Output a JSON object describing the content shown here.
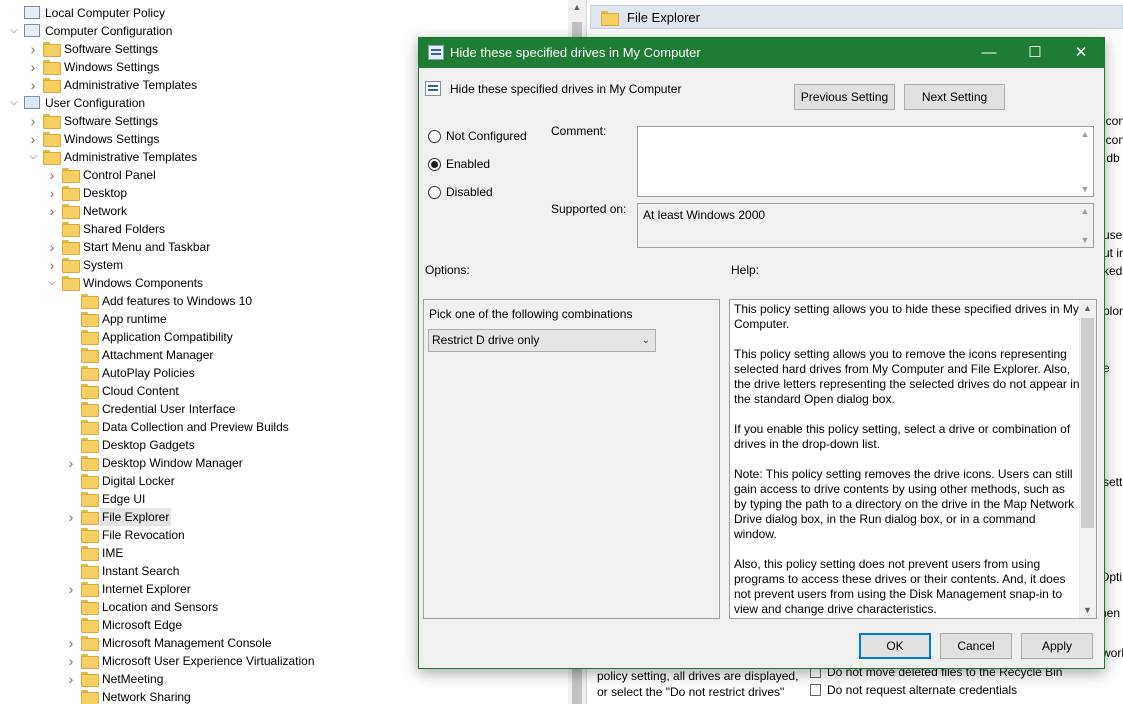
{
  "tree": {
    "items": [
      {
        "label": "Local Computer Policy",
        "level": 0,
        "chevron": "",
        "icon": "policy"
      },
      {
        "label": "Computer Configuration",
        "level": 0,
        "chevron": "down",
        "icon": "computer"
      },
      {
        "label": "Software Settings",
        "level": 1,
        "chevron": "right",
        "icon": "folder"
      },
      {
        "label": "Windows Settings",
        "level": 1,
        "chevron": "right",
        "icon": "folder"
      },
      {
        "label": "Administrative Templates",
        "level": 1,
        "chevron": "right",
        "icon": "folder"
      },
      {
        "label": "User Configuration",
        "level": 0,
        "chevron": "down",
        "icon": "user"
      },
      {
        "label": "Software Settings",
        "level": 1,
        "chevron": "right",
        "icon": "folder"
      },
      {
        "label": "Windows Settings",
        "level": 1,
        "chevron": "right",
        "icon": "folder"
      },
      {
        "label": "Administrative Templates",
        "level": 1,
        "chevron": "down",
        "icon": "folder"
      },
      {
        "label": "Control Panel",
        "level": 2,
        "chevron": "right",
        "icon": "folder"
      },
      {
        "label": "Desktop",
        "level": 2,
        "chevron": "right",
        "icon": "folder"
      },
      {
        "label": "Network",
        "level": 2,
        "chevron": "right",
        "icon": "folder"
      },
      {
        "label": "Shared Folders",
        "level": 2,
        "chevron": "",
        "icon": "folder"
      },
      {
        "label": "Start Menu and Taskbar",
        "level": 2,
        "chevron": "right",
        "icon": "folder"
      },
      {
        "label": "System",
        "level": 2,
        "chevron": "right",
        "icon": "folder"
      },
      {
        "label": "Windows Components",
        "level": 2,
        "chevron": "down",
        "icon": "folder"
      },
      {
        "label": "Add features to Windows 10",
        "level": 3,
        "chevron": "",
        "icon": "folder"
      },
      {
        "label": "App runtime",
        "level": 3,
        "chevron": "",
        "icon": "folder"
      },
      {
        "label": "Application Compatibility",
        "level": 3,
        "chevron": "",
        "icon": "folder"
      },
      {
        "label": "Attachment Manager",
        "level": 3,
        "chevron": "",
        "icon": "folder"
      },
      {
        "label": "AutoPlay Policies",
        "level": 3,
        "chevron": "",
        "icon": "folder"
      },
      {
        "label": "Cloud Content",
        "level": 3,
        "chevron": "",
        "icon": "folder"
      },
      {
        "label": "Credential User Interface",
        "level": 3,
        "chevron": "",
        "icon": "folder"
      },
      {
        "label": "Data Collection and Preview Builds",
        "level": 3,
        "chevron": "",
        "icon": "folder"
      },
      {
        "label": "Desktop Gadgets",
        "level": 3,
        "chevron": "",
        "icon": "folder"
      },
      {
        "label": "Desktop Window Manager",
        "level": 3,
        "chevron": "right",
        "icon": "folder"
      },
      {
        "label": "Digital Locker",
        "level": 3,
        "chevron": "",
        "icon": "folder"
      },
      {
        "label": "Edge UI",
        "level": 3,
        "chevron": "",
        "icon": "folder"
      },
      {
        "label": "File Explorer",
        "level": 3,
        "chevron": "right",
        "icon": "folder",
        "selected": true
      },
      {
        "label": "File Revocation",
        "level": 3,
        "chevron": "",
        "icon": "folder"
      },
      {
        "label": "IME",
        "level": 3,
        "chevron": "",
        "icon": "folder"
      },
      {
        "label": "Instant Search",
        "level": 3,
        "chevron": "",
        "icon": "folder"
      },
      {
        "label": "Internet Explorer",
        "level": 3,
        "chevron": "right",
        "icon": "folder"
      },
      {
        "label": "Location and Sensors",
        "level": 3,
        "chevron": "",
        "icon": "folder"
      },
      {
        "label": "Microsoft Edge",
        "level": 3,
        "chevron": "",
        "icon": "folder"
      },
      {
        "label": "Microsoft Management Console",
        "level": 3,
        "chevron": "right",
        "icon": "folder"
      },
      {
        "label": "Microsoft User Experience Virtualization",
        "level": 3,
        "chevron": "right",
        "icon": "folder"
      },
      {
        "label": "NetMeeting",
        "level": 3,
        "chevron": "right",
        "icon": "folder"
      },
      {
        "label": "Network Sharing",
        "level": 3,
        "chevron": "",
        "icon": "folder"
      }
    ]
  },
  "right_pane": {
    "header_title": "File Explorer",
    "fragments": [
      "icons",
      "icons",
      ".db",
      "users",
      "ut in",
      "ked",
      "plor",
      "e",
      "sett",
      "Opti",
      "nen",
      "work"
    ],
    "bottom_text": "policy setting, all drives are displayed, or select the \"Do not restrict drives\"",
    "policies": [
      "Do not move deleted files to the Recycle Bin",
      "Do not request alternate credentials"
    ]
  },
  "dialog": {
    "title": "Hide these specified drives in My Computer",
    "setting_name": "Hide these specified drives in My Computer",
    "previous_label": "Previous Setting",
    "next_label": "Next Setting",
    "radio_not_configured": "Not Configured",
    "radio_enabled": "Enabled",
    "radio_disabled": "Disabled",
    "selected_state": "Enabled",
    "comment_label": "Comment:",
    "comment_value": "",
    "supported_label": "Supported on:",
    "supported_value": "At least Windows 2000",
    "options_label": "Options:",
    "help_label": "Help:",
    "options_prompt": "Pick one of the following combinations",
    "drive_choice": "Restrict D drive only",
    "help_paragraphs": [
      "This policy setting allows you to hide these specified drives in My Computer.",
      "This policy setting allows you to remove the icons representing selected hard drives from My Computer and File Explorer. Also, the drive letters representing the selected drives do not appear in the standard Open dialog box.",
      "If you enable this policy setting, select a drive or combination of drives in the drop-down list.",
      "Note: This policy setting removes the drive icons. Users can still gain access to drive contents by using other methods, such as by typing the path to a directory on the drive in the Map Network Drive dialog box, in the Run dialog box, or in a command window.",
      "Also, this policy setting does not prevent users from using programs to access these drives or their contents. And, it does not prevent users from using the Disk Management snap-in to view and change drive characteristics."
    ],
    "ok_label": "OK",
    "cancel_label": "Cancel",
    "apply_label": "Apply"
  },
  "colors": {
    "title_bar": "#1e7d32",
    "selection": "#e5e5e5",
    "primary_border": "#0078d7"
  }
}
